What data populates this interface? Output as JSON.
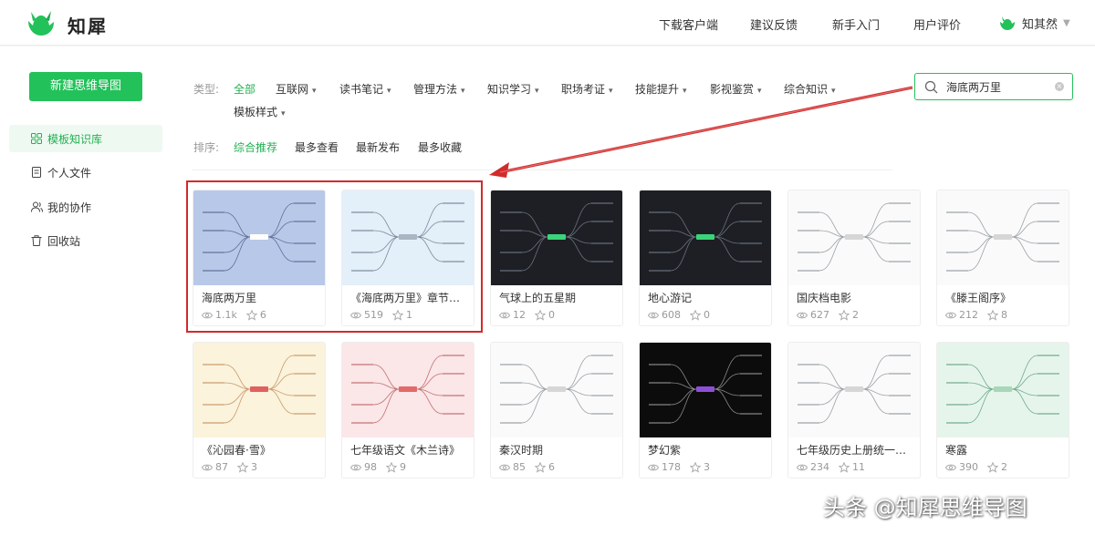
{
  "app": {
    "name": "知犀",
    "brand_color": "#23c15a"
  },
  "header": {
    "nav": [
      "下载客户端",
      "建议反馈",
      "新手入门",
      "用户评价"
    ],
    "user_name": "知其然"
  },
  "sidebar": {
    "new_button": "新建思维导图",
    "items": [
      {
        "label": "模板知识库",
        "icon": "grid-icon",
        "active": true
      },
      {
        "label": "个人文件",
        "icon": "file-icon",
        "active": false
      },
      {
        "label": "我的协作",
        "icon": "users-icon",
        "active": false
      },
      {
        "label": "回收站",
        "icon": "trash-icon",
        "active": false
      }
    ]
  },
  "filters": {
    "type_label": "类型:",
    "types": [
      "全部",
      "互联网",
      "读书笔记",
      "管理方法",
      "知识学习",
      "职场考证",
      "技能提升",
      "影视鉴赏",
      "综合知识",
      "模板样式"
    ],
    "sort_label": "排序:",
    "sorts": [
      "综合推荐",
      "最多查看",
      "最新发布",
      "最多收藏"
    ]
  },
  "search": {
    "value": "海底两万里"
  },
  "cards": [
    {
      "title": "海底两万里",
      "views": "1.1k",
      "stars": "6",
      "theme": "blue"
    },
    {
      "title": "《海底两万里》章节概括",
      "views": "519",
      "stars": "1",
      "theme": "lightblue"
    },
    {
      "title": "气球上的五星期",
      "views": "12",
      "stars": "0",
      "theme": "dark"
    },
    {
      "title": "地心游记",
      "views": "608",
      "stars": "0",
      "theme": "dark"
    },
    {
      "title": "国庆档电影",
      "views": "627",
      "stars": "2",
      "theme": "white"
    },
    {
      "title": "《滕王阁序》",
      "views": "212",
      "stars": "8",
      "theme": "white"
    },
    {
      "title": "《沁园春·雪》",
      "views": "87",
      "stars": "3",
      "theme": "cream"
    },
    {
      "title": "七年级语文《木兰诗》",
      "views": "98",
      "stars": "9",
      "theme": "pink"
    },
    {
      "title": "秦汉时期",
      "views": "85",
      "stars": "6",
      "theme": "white"
    },
    {
      "title": "梦幻紫",
      "views": "178",
      "stars": "3",
      "theme": "black"
    },
    {
      "title": "七年级历史上册统一多…",
      "views": "234",
      "stars": "11",
      "theme": "white"
    },
    {
      "title": "寒露",
      "views": "390",
      "stars": "2",
      "theme": "mint"
    }
  ],
  "watermark": "头条 @知犀思维导图"
}
